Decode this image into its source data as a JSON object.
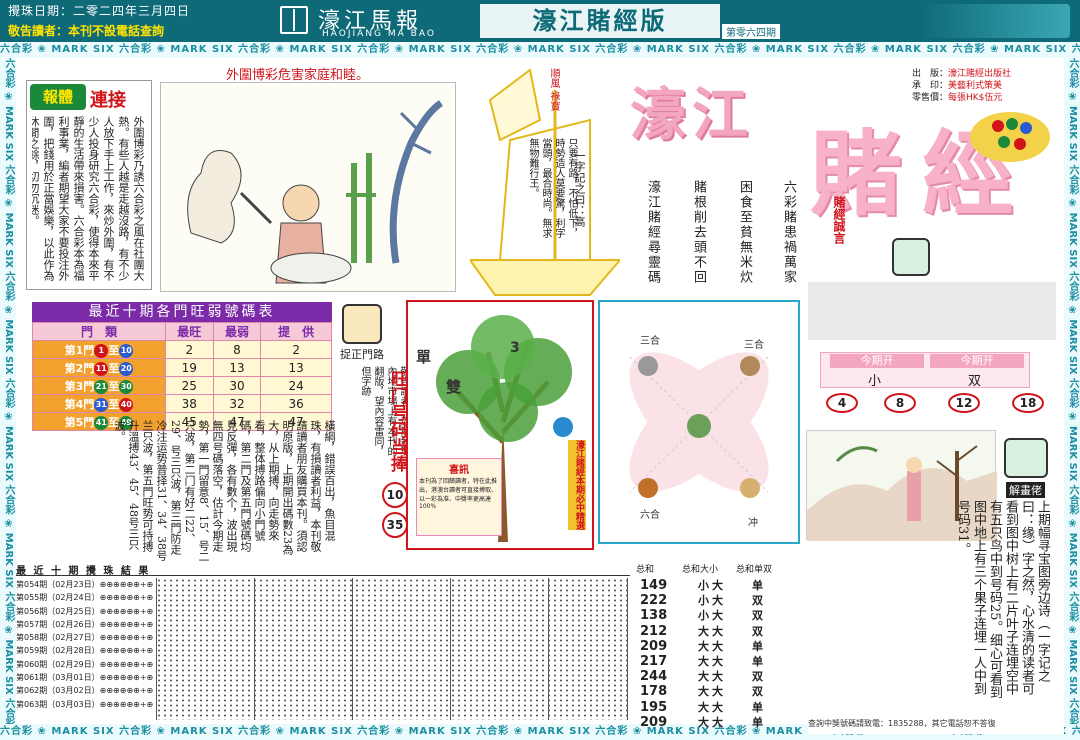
{
  "header": {
    "draw_date": "攪珠日期：二零二四年三月四日",
    "notice": "敬告讀者：本刊不設電話查詢",
    "paper_name": "濠江馬報",
    "paper_sub": "HAOJIANG MA BAO",
    "edition_title": "濠江賭經版",
    "issue_no": "第零六四期"
  },
  "border_strip": "六合彩 ❀ MARK SIX 六合彩 ❀ MARK SIX 六合彩 ❀ MARK SIX 六合彩 ❀ MARK SIX 六合彩 ❀ MARK SIX 六合彩 ❀ MARK SIX 六合彩 ❀ MARK SIX 六合彩 ❀ MARK SIX 六合彩 ❀ MARK SIX 六合彩 ❀ MARK SIX 六合彩",
  "article": {
    "badge_left": "報體",
    "badge_right": "連接",
    "caption": "外圍博彩危害家庭和睦。",
    "text": "外圍博彩乃誘六合彩之風在社團大熱。有些人越是走越沒路，有不少人放下手上工作，來炒外圍，有不少人投身研究六合彩，使得本來平靜的生活帶來損害。六合彩本為福利事業，編者期望大家不要投注外圍，把錢用於正當娛樂，以此作為休閒之餘，切勿沉迷。"
  },
  "boat": {
    "flag": "順風 祿寶",
    "poem": "只要有路，不怕低下，時勢造人莫要驚，利字當頭，最合時尚。無求無物難行王。",
    "word_riddle": "一字記之曰：高"
  },
  "proverbs": [
    "六彩賭患禍萬家",
    "困食至貧無米炊",
    "賭根削去頭不回",
    "濠江賭經尋靈碼"
  ],
  "masthead": {
    "pub_label": "出　版：",
    "pub_value": "濠江賭經出版社",
    "print_label": "承　印：",
    "print_value": "美藝利式策美",
    "price_label": "零售價：",
    "price_value": "每張HK$伍元",
    "big_title_1": "濠江",
    "big_title_2": "賭經",
    "sub": "賭經誠言"
  },
  "table": {
    "title": "最近十期各門旺弱號碼表",
    "headers": [
      "門　類",
      "最旺",
      "最弱",
      "提　供"
    ],
    "rows": [
      {
        "door": "第1門",
        "from": "1",
        "to": "10",
        "max": "2",
        "min": "8",
        "offer": "2"
      },
      {
        "door": "第2門",
        "from": "11",
        "to": "20",
        "max": "19",
        "min": "13",
        "offer": "13"
      },
      {
        "door": "第3門",
        "from": "21",
        "to": "30",
        "max": "25",
        "min": "30",
        "offer": "24"
      },
      {
        "door": "第4門",
        "from": "31",
        "to": "40",
        "max": "38",
        "min": "32",
        "offer": "36"
      },
      {
        "door": "第5門",
        "from": "41",
        "to": "49",
        "max": "45",
        "min": "47",
        "offer": "47"
      }
    ],
    "to_word": "至"
  },
  "catch_label": "捉正門路",
  "note_text": "敬告讀者，近期發現內地市場上有本刊的翻版，望內容雷同，但字跡",
  "hot": {
    "label": "旺门号码当捧",
    "n1": "10",
    "n2": "35"
  },
  "commentary": "橫綱，錯誤百出，魚目混珠，有損讀者利益，本刊敬請讀者朋友購買本刊。須認明原版，上期開出碼數23為大，从上期搏，向走勢來看，整体搏路偏向小門號碼，第二門及第五門號碼均見反彈，各有數个，波出現無四号碼落空，估計今期走勢，第一門留意8、15、号二只波，第二门有好二22、29、号三只波，第三門防走冷注运势普择31、34、38号兰只波，第五門旺势可持搏升溫搏43、45、48号三只波。",
  "tree": {
    "good_news_title": "喜訊",
    "good_news_text": "本刊為了回饋讀者，特在此推出，港澳台讀者可直接搏取、以一彩為准、中獎率更高達100%",
    "side_label": "濠江賭經本期必中精選",
    "label_single": "單",
    "label_double": "雙",
    "label_3": "3"
  },
  "zodiac": {
    "tl": "三合",
    "tr": "三合",
    "bl": "六合",
    "br": "冲"
  },
  "next_draw": {
    "head1": "今期开",
    "head2": "今期开",
    "val1": "小",
    "val2": "双",
    "balls": [
      "4",
      "8",
      "12",
      "18"
    ]
  },
  "riddle": {
    "label": "解畫佬",
    "text": "上期幅寻宝图旁边诗（一字记之曰：缘）字之然，心水清的读者可看到图中树上有二片叶子连埋空中有五只鸟中到号码25。细心可看到图中地上有三个果子连埋一人中到号码31。",
    "inquiry": "查詢中獎號碼請致電：1835288，其它電話恕不答復"
  },
  "results": {
    "title": "最 近 十 期 攪 珠 結 果",
    "rows": [
      "第054期（02月23日）⊕⊕⊕⊕⊕⊕+⊕",
      "第055期（02月24日）⊕⊕⊕⊕⊕⊕+⊕",
      "第056期（02月25日）⊕⊕⊕⊕⊕⊕+⊕",
      "第057期（02月26日）⊕⊕⊕⊕⊕⊕+⊕",
      "第058期（02月27日）⊕⊕⊕⊕⊕⊕+⊕",
      "第059期（02月28日）⊕⊕⊕⊕⊕⊕+⊕",
      "第060期（02月29日）⊕⊕⊕⊕⊕⊕+⊕",
      "第061期（03月01日）⊕⊕⊕⊕⊕⊕+⊕",
      "第062期（03月02日）⊕⊕⊕⊕⊕⊕+⊕",
      "第063期（03月03日）⊕⊕⊕⊕⊕⊕+⊕"
    ],
    "col_heads": [
      "总和",
      "总和大小",
      "总和单双"
    ],
    "totals": [
      "149",
      "222",
      "138",
      "212",
      "209",
      "217",
      "244",
      "178",
      "195",
      "209"
    ],
    "size": [
      "小大",
      "小大",
      "小大",
      "大大",
      "大大",
      "大大",
      "大大",
      "大大",
      "大大",
      "大大"
    ],
    "parity": [
      "单",
      "双",
      "双",
      "双",
      "单",
      "单",
      "双",
      "双",
      "单",
      "单"
    ]
  },
  "colors": {
    "teal": "#0f6a78",
    "red": "#d0141a",
    "purple": "#7b2aa8",
    "pink": "#f3a6c0",
    "orange": "#f2a12e"
  }
}
